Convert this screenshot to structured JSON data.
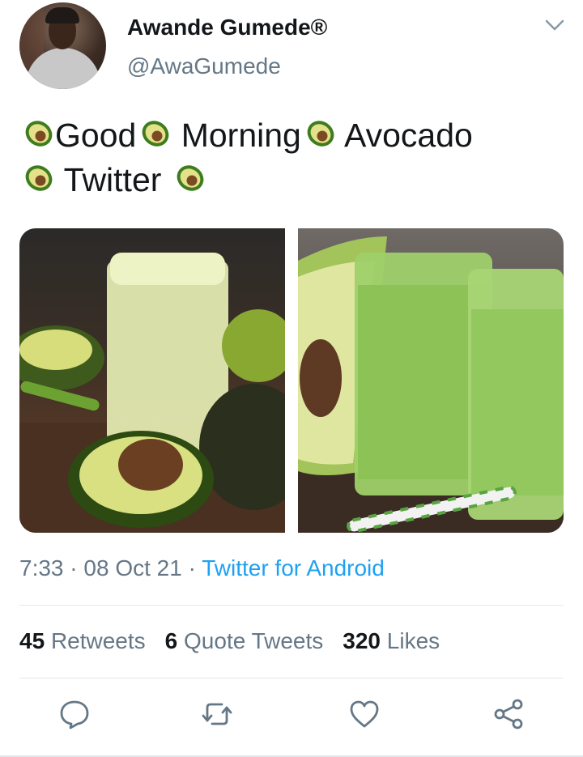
{
  "tweet": {
    "author": {
      "name": "Awande Gumede®",
      "handle": "@AwaGumede"
    },
    "text": {
      "line1_word1": "Good",
      "line1_word2": "Morning",
      "line1_word3": "Avocado",
      "line2_word1": "Twitter"
    },
    "media": [
      {
        "description_icon": "avocado-smoothie-photo"
      },
      {
        "description_icon": "green-smoothie-glasses-photo"
      }
    ],
    "meta": {
      "time": "7:33",
      "separator": "·",
      "date": "08 Oct 21",
      "source": "Twitter for Android"
    },
    "stats": {
      "retweets_count": "45",
      "retweets_label": "Retweets",
      "quotes_count": "6",
      "quotes_label": "Quote Tweets",
      "likes_count": "320",
      "likes_label": "Likes"
    },
    "actions": {
      "reply_icon": "reply-icon",
      "retweet_icon": "retweet-icon",
      "like_icon": "heart-icon",
      "share_icon": "share-icon"
    },
    "colors": {
      "link": "#1da1f2",
      "secondary": "#657786",
      "primary": "#14171a"
    }
  }
}
